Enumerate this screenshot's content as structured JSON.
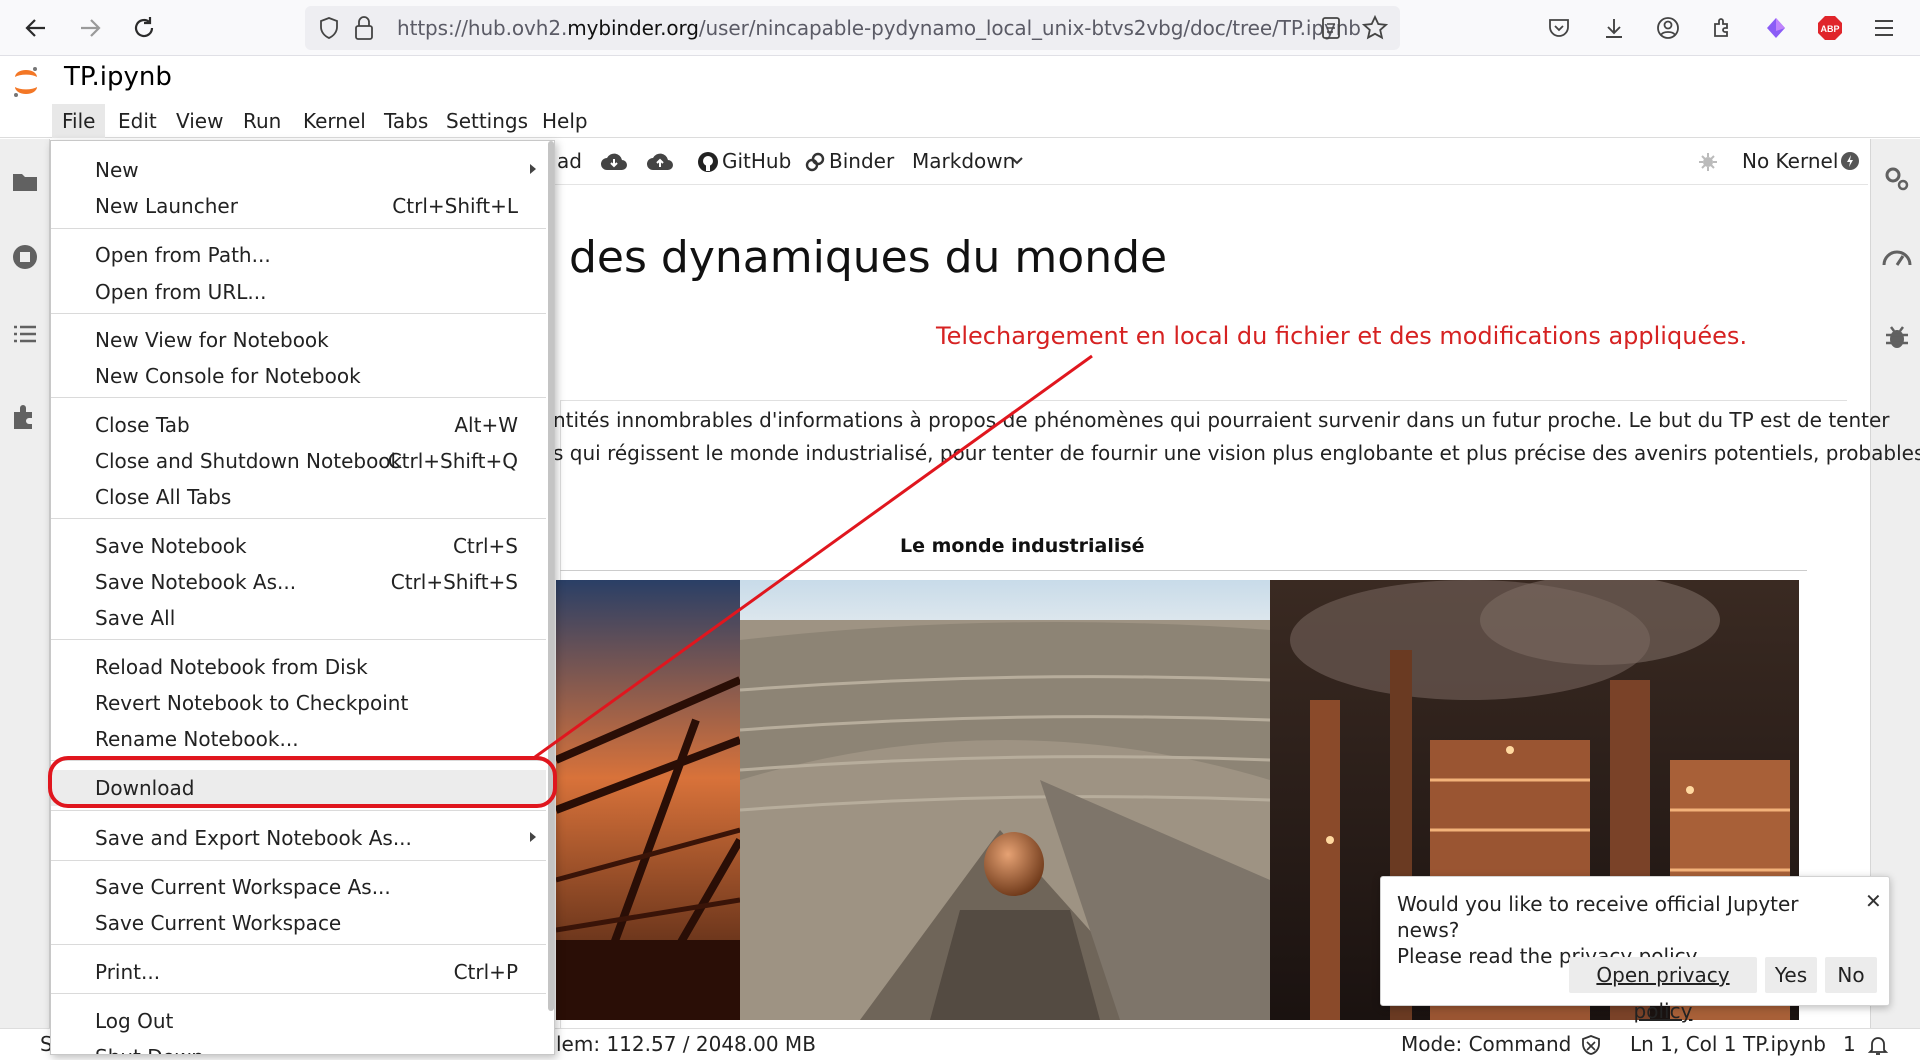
{
  "browser": {
    "url_prefix": "https://hub.ovh2.",
    "url_domain": "mybinder.org",
    "url_path": "/user/nincapable-pydynamo_local_unix-btvs2vbg/doc/tree/TP.ipynb"
  },
  "jupyter": {
    "title": "TP.ipynb",
    "menus": [
      "File",
      "Edit",
      "View",
      "Run",
      "Kernel",
      "Tabs",
      "Settings",
      "Help"
    ]
  },
  "toolbar": {
    "partial_label": "ad",
    "github_label": "GitHub",
    "binder_label": "Binder",
    "cell_type": "Markdown",
    "kernel_label": "No Kernel"
  },
  "notebook": {
    "heading_fragment": "des dynamiques du monde",
    "para_line1": "ntités innombrables d'informations à propos de phénomènes qui pourraient survenir dans un futur proche. Le but du TP est de tenter",
    "para_line2": "s qui régissent le monde industrialisé, pour tenter de fournir une vision plus englobante et plus précise des avenirs potentiels, probables",
    "image_caption": "Le monde industrialisé"
  },
  "annotation": {
    "text": "Telechargement en local du fichier et des modifications appliquées.",
    "color": "#d62222"
  },
  "file_menu": {
    "items": [
      {
        "label": "New",
        "shortcut": "",
        "submenu": true
      },
      {
        "label": "New Launcher",
        "shortcut": "Ctrl+Shift+L"
      },
      {
        "label": "Open from Path...",
        "shortcut": ""
      },
      {
        "label": "Open from URL...",
        "shortcut": ""
      },
      {
        "label": "New View for Notebook",
        "shortcut": ""
      },
      {
        "label": "New Console for Notebook",
        "shortcut": ""
      },
      {
        "label": "Close Tab",
        "shortcut": "Alt+W"
      },
      {
        "label": "Close and Shutdown Notebook",
        "shortcut": "Ctrl+Shift+Q"
      },
      {
        "label": "Close All Tabs",
        "shortcut": ""
      },
      {
        "label": "Save Notebook",
        "shortcut": "Ctrl+S"
      },
      {
        "label": "Save Notebook As...",
        "shortcut": "Ctrl+Shift+S"
      },
      {
        "label": "Save All",
        "shortcut": ""
      },
      {
        "label": "Reload Notebook from Disk",
        "shortcut": ""
      },
      {
        "label": "Revert Notebook to Checkpoint",
        "shortcut": ""
      },
      {
        "label": "Rename Notebook...",
        "shortcut": ""
      },
      {
        "label": "Download",
        "shortcut": ""
      },
      {
        "label": "Save and Export Notebook As...",
        "shortcut": "",
        "submenu": true
      },
      {
        "label": "Save Current Workspace As...",
        "shortcut": ""
      },
      {
        "label": "Save Current Workspace",
        "shortcut": ""
      },
      {
        "label": "Print...",
        "shortcut": "Ctrl+P"
      },
      {
        "label": "Log Out",
        "shortcut": ""
      },
      {
        "label": "Shut Down",
        "shortcut": ""
      }
    ]
  },
  "statusbar": {
    "memory": "lem: 112.57 / 2048.00 MB",
    "mode": "Mode: Command",
    "position": "Ln 1, Col 1",
    "filename": "TP.ipynb",
    "notifications": "1",
    "left_char": "S"
  },
  "toast": {
    "message_line1": "Would you like to receive official Jupyter news?",
    "message_line2": "Please read the privacy policy.",
    "privacy_link": "Open privacy policy",
    "yes_label": "Yes",
    "no_label": "No",
    "close_symbol": "✕"
  }
}
